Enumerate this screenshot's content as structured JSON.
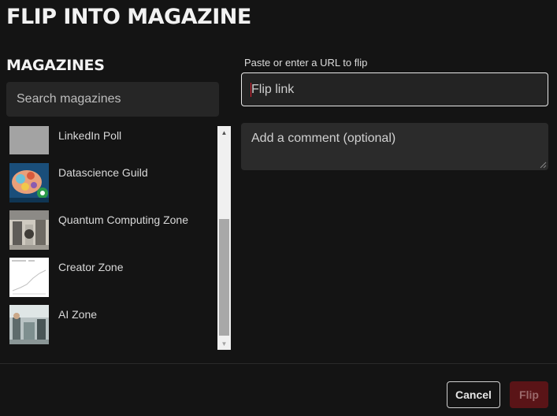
{
  "dialog": {
    "title": "FLIP INTO MAGAZINE"
  },
  "magazines": {
    "heading": "MAGAZINES",
    "search_placeholder": "Search magazines",
    "items": [
      {
        "label": "LinkedIn Poll",
        "thumb": "gray-placeholder"
      },
      {
        "label": "Datascience Guild",
        "thumb": "brain-illustration"
      },
      {
        "label": "Quantum Computing Zone",
        "thumb": "lab-photo"
      },
      {
        "label": "Creator Zone",
        "thumb": "line-chart-doc"
      },
      {
        "label": "AI Zone",
        "thumb": "robot-lab-photo"
      }
    ]
  },
  "flip_form": {
    "url_label": "Paste or enter a URL to flip",
    "url_placeholder": "Flip link",
    "comment_placeholder": "Add a comment (optional)"
  },
  "footer": {
    "cancel_label": "Cancel",
    "flip_label": "Flip"
  },
  "colors": {
    "background": "#141414",
    "accent_red": "#e11d2f",
    "flip_button_disabled": "#5a1417"
  }
}
